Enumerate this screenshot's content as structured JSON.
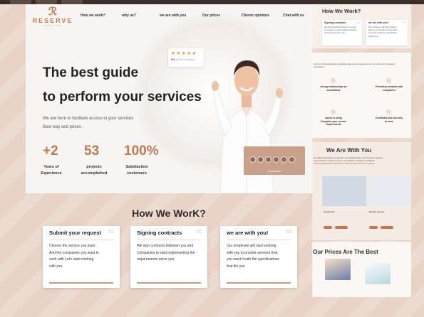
{
  "brand": {
    "name": "RESERVE",
    "tagline": "SAVE TIME"
  },
  "nav": [
    "How we work?",
    "why us?",
    "we are with you",
    "Our prices",
    "Clients opinions",
    "Chat with us"
  ],
  "hero": {
    "title_line1": "The best guide",
    "title_line2": "to perform your services",
    "subtitle_line1": "We are here to facilitate access to your services",
    "subtitle_line2": "Best way and prices .",
    "rating_stars": "★★★★★",
    "rating_value": "5.0",
    "rating_suffix": "(1000 reviews)"
  },
  "stats": [
    {
      "value": "+2",
      "label_line1": "Years of",
      "label_line2": "Experience"
    },
    {
      "value": "53",
      "label_line1": "projects",
      "label_line2": "accomplished"
    },
    {
      "value": "100%",
      "label_line1": "Satisfaction",
      "label_line2": "customers"
    }
  ],
  "freelancer_label": "Freelancer",
  "how_we_work": {
    "title": "How We WorK?",
    "cards": [
      {
        "title": "Submit your request",
        "num": "01",
        "lines": [
          "Choose the service you want",
          "And the companies you want to",
          "work with Let's start working",
          "with you"
        ]
      },
      {
        "title": "Signing contracts",
        "num": "02",
        "lines": [
          "We sign contracts between you and",
          "Companies to start implementing the",
          "requirements serve you"
        ]
      },
      {
        "title": "we are with you!",
        "num": "03",
        "lines": [
          "Our employee will start working",
          "with you to provide services that",
          "you want it with the specifications",
          "that fits you"
        ]
      }
    ]
  },
  "right_column": {
    "how_title": "How We Work?",
    "mini_cards": [
      {
        "title": "Signing contracts",
        "num": "02",
        "lines": [
          "We sign contracts between you and",
          "Companies to start implementing the",
          "requirements serve you"
        ]
      },
      {
        "title": "we are with you!",
        "num": "03",
        "lines": [
          "Our employee will start working",
          "with you to provide services that",
          "you want it with the specification",
          "that fits you"
        ]
      }
    ],
    "why_intro_1": "which is [intermediaries] to facilitate that service requirements you need by companies",
    "why_intro_2": "specialized",
    "features": [
      "strong relationships as consultants",
      "Providing contacts with companies",
      "speed in using Complete your service requirements",
      "Credibility and sincerity at work"
    ],
    "with_title": "We Are With You",
    "with_line1": "the skilled specialized employee immediately after receiving your request",
    "with_line2": "result of all the matters of your event will be complete completion",
    "with_line3": "best distinguished employees who do their job to the fullest",
    "employees": [
      "Ammar Ali",
      "Khaled Yousef"
    ],
    "prices_title": "Our Prices Are The Best"
  },
  "colors": {
    "accent": "#c07a4e",
    "background": "#e8d3c6",
    "card": "#f7f5f3"
  }
}
